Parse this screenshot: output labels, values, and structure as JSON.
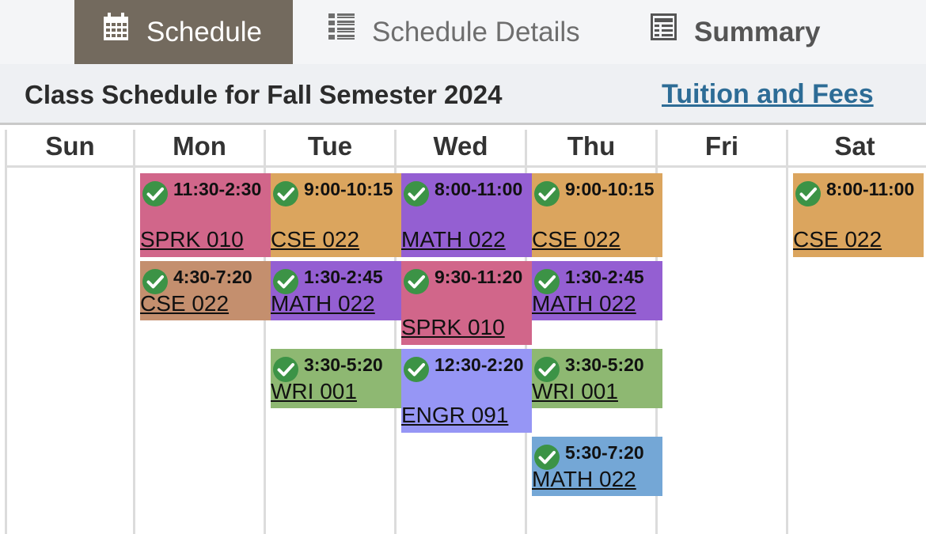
{
  "tabs": [
    {
      "label": "Schedule",
      "icon": "calendar-icon",
      "active": true
    },
    {
      "label": "Schedule Details",
      "icon": "list-icon",
      "active": false
    },
    {
      "label": "Summary",
      "icon": "table-icon",
      "active": false
    }
  ],
  "header": {
    "title": "Class Schedule for Fall Semester 2024",
    "fees_link": "Tuition and Fees"
  },
  "days": [
    "Sun",
    "Mon",
    "Tue",
    "Wed",
    "Thu",
    "Fri",
    "Sat"
  ],
  "colors": {
    "active_tab": "#736a5e",
    "link": "#2d6c96",
    "pink": "#d1668a",
    "orange": "#dba55e",
    "purple": "#945fd2",
    "tan": "#c48f6e",
    "green": "#8eb872",
    "periwinkle": "#9696f5",
    "blue": "#74a7d6",
    "check": "#3c9346"
  },
  "events": [
    {
      "day": "Mon",
      "time": "11:30-2:30",
      "course": "SPRK 010",
      "color": "#d1668a"
    },
    {
      "day": "Mon",
      "time": "4:30-7:20",
      "course": "CSE 022",
      "color": "#c48f6e"
    },
    {
      "day": "Tue",
      "time": "9:00-10:15",
      "course": "CSE 022",
      "color": "#dba55e"
    },
    {
      "day": "Tue",
      "time": "1:30-2:45",
      "course": "MATH 022",
      "color": "#945fd2"
    },
    {
      "day": "Tue",
      "time": "3:30-5:20",
      "course": "WRI 001",
      "color": "#8eb872"
    },
    {
      "day": "Wed",
      "time": "8:00-11:00",
      "course": "MATH 022",
      "color": "#945fd2"
    },
    {
      "day": "Wed",
      "time": "9:30-11:20",
      "course": "SPRK 010",
      "color": "#d1668a"
    },
    {
      "day": "Wed",
      "time": "12:30-2:20",
      "course": "ENGR 091",
      "color": "#9696f5"
    },
    {
      "day": "Thu",
      "time": "9:00-10:15",
      "course": "CSE 022",
      "color": "#dba55e"
    },
    {
      "day": "Thu",
      "time": "1:30-2:45",
      "course": "MATH 022",
      "color": "#945fd2"
    },
    {
      "day": "Thu",
      "time": "3:30-5:20",
      "course": "WRI 001",
      "color": "#8eb872"
    },
    {
      "day": "Thu",
      "time": "5:30-7:20",
      "course": "MATH 022",
      "color": "#74a7d6"
    },
    {
      "day": "Sat",
      "time": "8:00-11:00",
      "course": "CSE 022",
      "color": "#dba55e"
    }
  ]
}
